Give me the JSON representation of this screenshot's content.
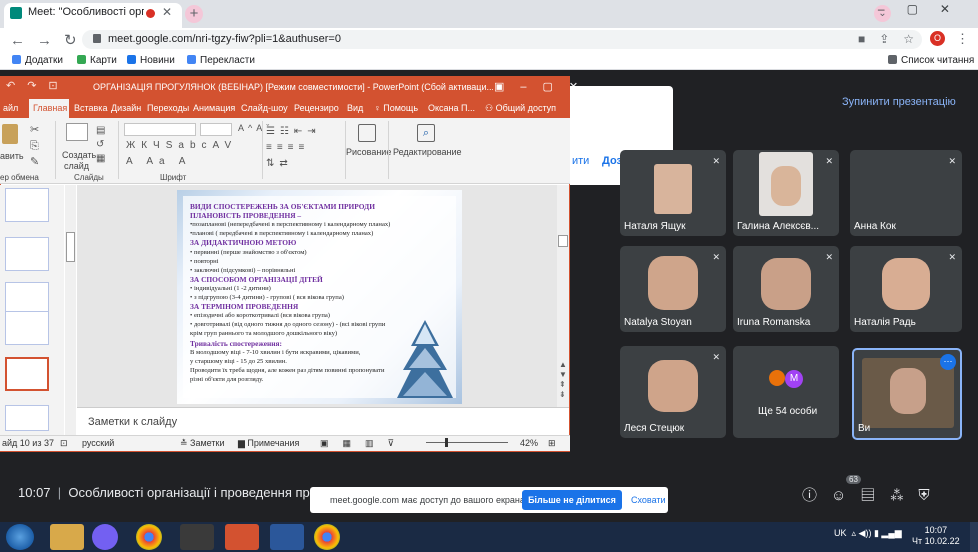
{
  "browser": {
    "tab_title": "Meet: \"Особливості організ",
    "url": "meet.google.com/nri-tgzy-fiw?pli=1&authuser=0",
    "profile_initial": "O",
    "bookmarks": [
      {
        "label": "Додатки",
        "color": "#4285f4"
      },
      {
        "label": "Карти",
        "color": "#34a853"
      },
      {
        "label": "Новини",
        "color": "#1a73e8"
      },
      {
        "label": "Перекласти",
        "color": "#4285f4"
      }
    ],
    "reading_list": "Список читання"
  },
  "meet": {
    "stop_presenting": "Зупинити презентацію",
    "share_cut": "ити",
    "allow": "Дозволити",
    "participants": [
      {
        "name": "Наталя Ящук",
        "face": "#d8b49c"
      },
      {
        "name": "Галина Алексєв...",
        "face": "#d9b59a"
      },
      {
        "name": "Анна Кок",
        "face": null
      },
      {
        "name": "Natalya Stoyan",
        "face": "#cfa58b"
      },
      {
        "name": "Iruna Romanska",
        "face": "#c9a088"
      },
      {
        "name": "Наталія Радь",
        "face": "#d8ad93"
      },
      {
        "name": "Леся Стецюк",
        "face": "#cfa48a"
      },
      {
        "name": "Ще 54 особи",
        "face": null
      },
      {
        "name": "Ви",
        "face": "#5a4a3a"
      }
    ],
    "others_avatar": "M",
    "meeting_time": "10:07",
    "meeting_title": "Особливості організації і проведення прогу",
    "participants_badge": "63",
    "share_bar_text": "meet.google.com має доступ до вашого екрана.",
    "stop_share": "Більше не ділитися",
    "hide": "Сховати"
  },
  "ppt": {
    "title": "ОРГАНІЗАЦІЯ ПРОГУЛЯНОК (ВЕБІНАР) [Режим совместимости] - PowerPoint (Сбой активаци...",
    "tabs": [
      "айл",
      "Главная",
      "Вставка",
      "Дизайн",
      "Переходы",
      "Анимация",
      "Слайд-шоу",
      "Рецензиро",
      "Вид",
      "Помощь",
      "Оксана П...",
      "Общий доступ"
    ],
    "ribbon": {
      "paste": "авить",
      "clipboard": "ер обмена",
      "create_slide": "Создать",
      "create_slide2": "слайд",
      "slides": "Слайды",
      "font": "Шрифт",
      "drawing": "Рисование",
      "editing": "Редактирование"
    },
    "slide_numbers": [
      "",
      "",
      "",
      "",
      "",
      ""
    ],
    "notes": "Заметки к слайду",
    "status": {
      "slide": "айд 10 из 37",
      "lang": "русский",
      "notes": "Заметки",
      "comments": "Примечания",
      "zoom": "42%"
    }
  },
  "slide": {
    "lines": [
      {
        "t": "ВИДИ СПОСТЕРЕЖЕНЬ ЗА ОБ'ЄКТАМИ ПРИРОДИ",
        "h": true
      },
      {
        "t": "ПЛАНОВІСТЬ ПРОВЕДЕННЯ –",
        "h": true
      },
      {
        "t": "•позапланові (непередбачені в перспективному і календарному планах)",
        "h": false
      },
      {
        "t": "•планові ( передбачені в перспективному і календарному планах)",
        "h": false
      },
      {
        "t": "ЗА ДИДАКТИЧНОЮ МЕТОЮ",
        "h": true
      },
      {
        "t": "•  первинні (перше знайомство з об'єктом)",
        "h": false
      },
      {
        "t": "•  повторні",
        "h": false
      },
      {
        "t": "•  заключні (підсумкові) – порівняльні",
        "h": false
      },
      {
        "t": "ЗА СПОСОБОМ ОРГАНІЗАЦІЇ ДІТЕЙ",
        "h": true
      },
      {
        "t": "• індивідуальні (1 -2 дитини)",
        "h": false
      },
      {
        "t": "• з підгрупою (3-4 дитини) - групові ( вся вікова група)",
        "h": false
      },
      {
        "t": "ЗА ТЕРМІНОМ ПРОВЕДЕННЯ",
        "h": true
      },
      {
        "t": "• епізодичні або короткотривалі (вся вікова група)",
        "h": false
      },
      {
        "t": "• довготривалі (від одного тижня до одного сезону) - (всі вікові групи",
        "h": false
      },
      {
        "t": "крім груп раннього та молодшого дошкільного віку)",
        "h": false
      },
      {
        "t": "Тривалість  спостереження:",
        "h": true
      },
      {
        "t": "В молодшому віці - 7-10 хвилин і бути яскравими, цікавими,",
        "h": false
      },
      {
        "t": "у старшому віці - 15 до 25 хвилин.",
        "h": false
      },
      {
        "t": "Проводити їх треба щодня, але кожен раз дітям повинні пропонувати",
        "h": false
      },
      {
        "t": "різні об'єкти для розгляду.",
        "h": false
      }
    ]
  },
  "taskbar": {
    "lang": "UK",
    "time": "10:07",
    "date": "Чт 10.02.22"
  }
}
